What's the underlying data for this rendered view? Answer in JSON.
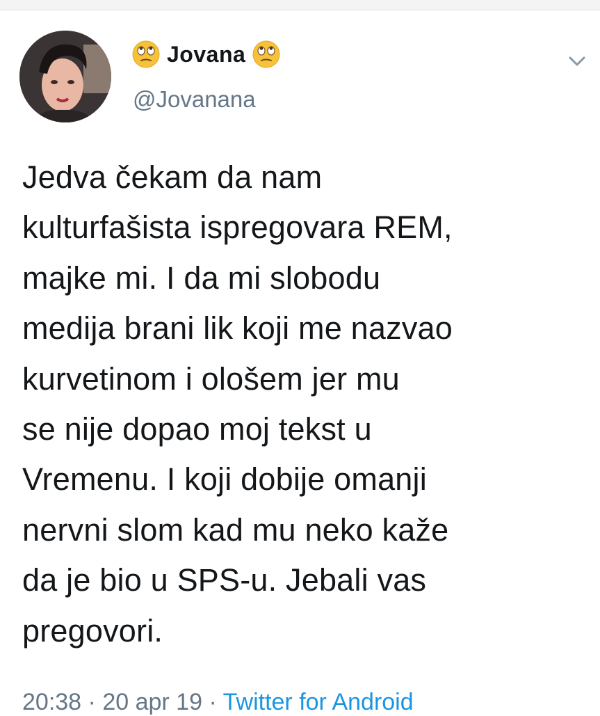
{
  "tweet": {
    "display_name": "Jovana",
    "name_emoji_left": "face-with-rolling-eyes-emoji",
    "name_emoji_right": "face-with-rolling-eyes-emoji",
    "handle": "@Jovanana",
    "text": "Jedva čekam da nam\nkulturfašista ispregovara REM,\nmajke mi. I da mi slobodu\nmedija brani lik koji me nazvao\nkurvetinom i ološem jer mu\nse nije dopao moj tekst u\nVremenu. I koji dobije omanji\nnervni slom kad mu neko kaže\nda je bio u SPS-u. Jebali vas\npregovori.",
    "time": "20:38",
    "separator": "·",
    "date": "20 apr 19",
    "source": "Twitter for Android"
  },
  "icons": {
    "menu": "chevron-down-icon",
    "avatar": "profile-photo"
  },
  "colors": {
    "text": "#14171a",
    "secondary": "#657786",
    "link": "#1b95e0"
  }
}
